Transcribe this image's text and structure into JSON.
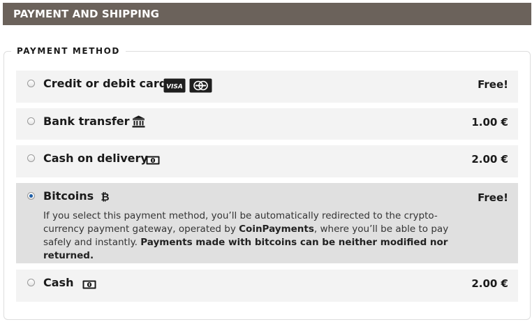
{
  "header": {
    "title": "PAYMENT AND SHIPPING"
  },
  "payment": {
    "legend": "PAYMENT METHOD",
    "selected_index": 3,
    "options": [
      {
        "label": "Credit or debit card",
        "price": "Free!",
        "icons": [
          "visa-icon",
          "mastercard-icon"
        ],
        "visa_text": "VISA"
      },
      {
        "label": "Bank transfer",
        "price": "1.00 €",
        "icons": [
          "bank-icon"
        ]
      },
      {
        "label": "Cash on delivery",
        "price": "2.00 €",
        "icons": [
          "banknote-icon"
        ]
      },
      {
        "label": "Bitcoins",
        "price": "Free!",
        "icons": [
          "bitcoin-icon"
        ],
        "description": {
          "part1": "If you select this payment method, you’ll be automatically redirected to the crypto-currency payment gateway, operated by ",
          "part2_bold": "CoinPayments",
          "part3": ", where you’ll be able to pay safely and instantly. ",
          "part4_bold": "Payments made with bitcoins can be neither modified nor returned."
        }
      },
      {
        "label": "Cash",
        "price": "2.00 €",
        "icons": [
          "banknote-icon"
        ]
      }
    ]
  },
  "colors": {
    "header_bg": "#6b625b",
    "option_bg": "#f3f3f3",
    "selected_bg": "#e0e0e0",
    "radio_checked": "#1f5fa8"
  }
}
